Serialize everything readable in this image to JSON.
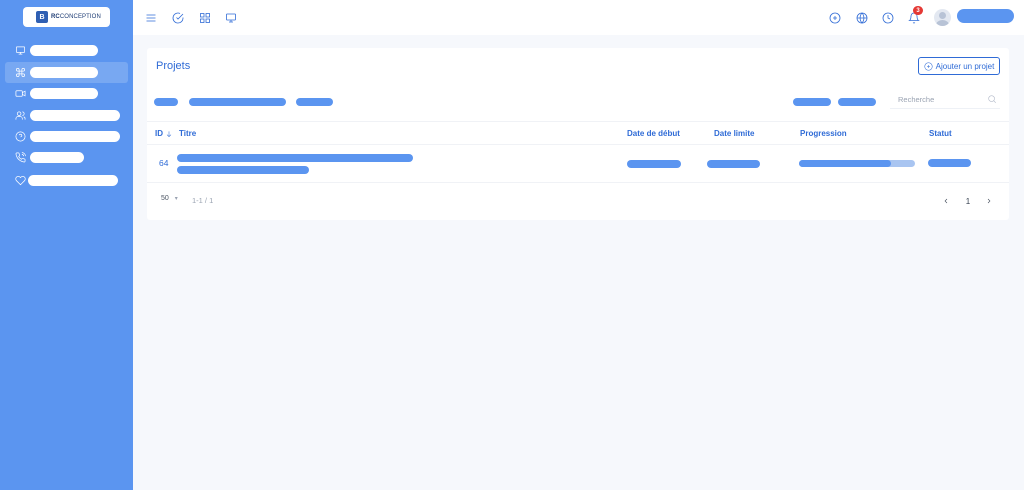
{
  "app": {
    "logo_mark": "B",
    "logo_brand": "RC",
    "logo_name": "CONCEPTION"
  },
  "sidebar": {
    "items": [
      {
        "icon": "monitor-icon",
        "active": false
      },
      {
        "icon": "command-icon",
        "active": true
      },
      {
        "icon": "video-icon",
        "active": false
      },
      {
        "icon": "users-icon",
        "active": false
      },
      {
        "icon": "help-circle-icon",
        "active": false
      },
      {
        "icon": "phone-call-icon",
        "active": false
      },
      {
        "icon": "heart-icon",
        "active": false
      }
    ]
  },
  "topbar": {
    "left_icons": [
      "menu-icon",
      "check-circle-icon",
      "grid-icon",
      "monitor-icon"
    ],
    "right_icons": [
      "plus-circle-icon",
      "globe-icon",
      "clock-icon",
      "bell-icon"
    ],
    "notification_count": "3"
  },
  "page": {
    "title": "Projets",
    "add_button_label": "Ajouter un projet",
    "search_placeholder": "Recherche"
  },
  "table": {
    "columns": {
      "id": "ID",
      "title": "Titre",
      "start_date": "Date de début",
      "deadline": "Date limite",
      "progress": "Progression",
      "status": "Statut"
    },
    "rows": [
      {
        "id": "64",
        "progress": 0.79
      }
    ]
  },
  "pagination": {
    "per_page": "50",
    "range": "1-1 / 1",
    "current_page": "1"
  },
  "colors": {
    "sidebar": "#5b95f0",
    "accent": "#2f6bd6",
    "placeholder_bar": "#5b95f0",
    "notification": "#e53935"
  }
}
